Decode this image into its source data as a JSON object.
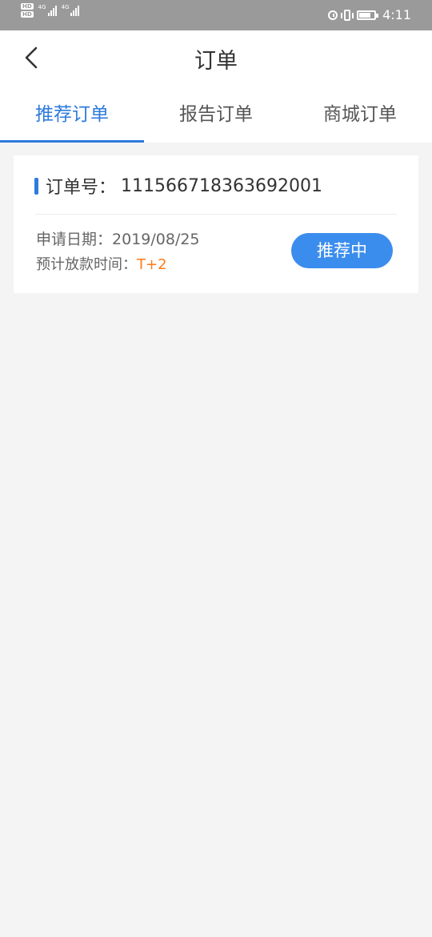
{
  "status_bar": {
    "hd_badges": [
      "HD",
      "HD"
    ],
    "network_tags": [
      "4G",
      "4G"
    ],
    "time": "4:11",
    "battery_level": 0.8,
    "icons": [
      "alarm-icon",
      "vibrate-icon",
      "battery-icon"
    ]
  },
  "header": {
    "title": "订单",
    "back_icon": "chevron-left-icon"
  },
  "tabs": [
    {
      "label": "推荐订单",
      "active": true
    },
    {
      "label": "报告订单",
      "active": false
    },
    {
      "label": "商城订单",
      "active": false
    }
  ],
  "order": {
    "number_label": "订单号：",
    "number_value": "111566718363692001",
    "apply_date_label": "申请日期：",
    "apply_date_value": "2019/08/25",
    "payout_label": "预计放款时间：",
    "payout_value": "T+2",
    "status_label": "推荐中"
  },
  "colors": {
    "accent": "#2e7bdc",
    "button": "#3b8ded",
    "highlight": "#ff7a1a",
    "status_bar": "#9a9a9a",
    "background": "#f4f4f4"
  }
}
